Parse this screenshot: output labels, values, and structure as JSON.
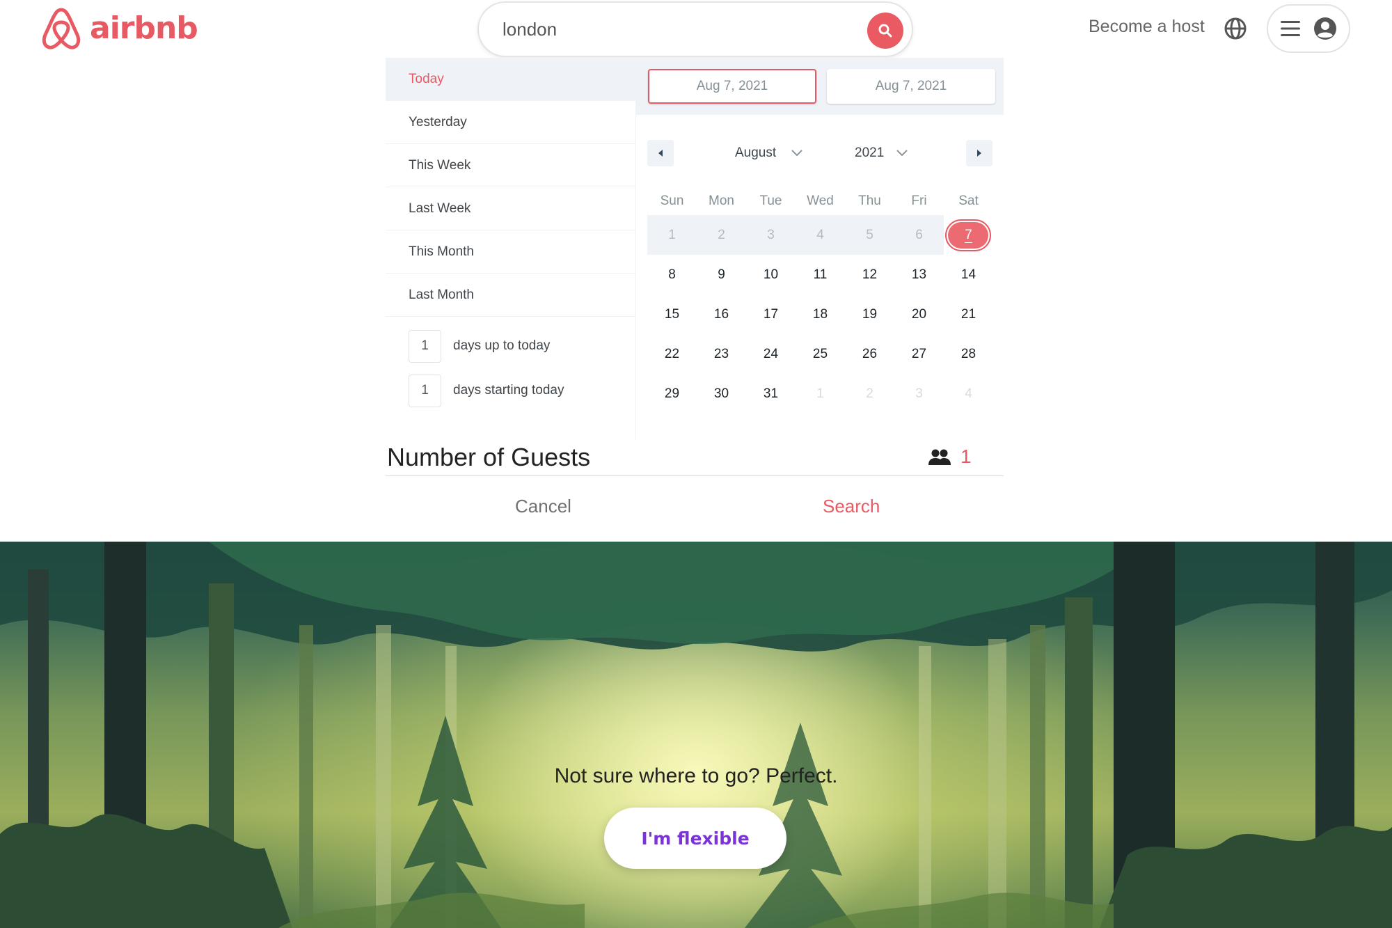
{
  "header": {
    "brand": "airbnb",
    "search_value": "london",
    "become_host": "Become a host",
    "icons": [
      "airbnb-logo-icon",
      "search-icon",
      "globe-icon",
      "hamburger-icon",
      "user-circle-icon"
    ]
  },
  "date_picker": {
    "static_ranges": [
      {
        "label": "Today",
        "active": true
      },
      {
        "label": "Yesterday",
        "active": false
      },
      {
        "label": "This Week",
        "active": false
      },
      {
        "label": "Last Week",
        "active": false
      },
      {
        "label": "This Month",
        "active": false
      },
      {
        "label": "Last Month",
        "active": false
      }
    ],
    "input_ranges": [
      {
        "value": "1",
        "label": "days up to today"
      },
      {
        "value": "1",
        "label": "days starting today"
      }
    ],
    "start_date": "Aug 7, 2021",
    "end_date": "Aug 7, 2021",
    "month": "August",
    "year": "2021",
    "weekdays": [
      "Sun",
      "Mon",
      "Tue",
      "Wed",
      "Thu",
      "Fri",
      "Sat"
    ],
    "days": [
      {
        "d": "1",
        "state": "inrow"
      },
      {
        "d": "2",
        "state": "inrow"
      },
      {
        "d": "3",
        "state": "inrow"
      },
      {
        "d": "4",
        "state": "inrow"
      },
      {
        "d": "5",
        "state": "inrow"
      },
      {
        "d": "6",
        "state": "inrow"
      },
      {
        "d": "7",
        "state": "selected"
      },
      {
        "d": "8",
        "state": "normal"
      },
      {
        "d": "9",
        "state": "normal"
      },
      {
        "d": "10",
        "state": "normal"
      },
      {
        "d": "11",
        "state": "normal"
      },
      {
        "d": "12",
        "state": "normal"
      },
      {
        "d": "13",
        "state": "normal"
      },
      {
        "d": "14",
        "state": "normal"
      },
      {
        "d": "15",
        "state": "normal"
      },
      {
        "d": "16",
        "state": "normal"
      },
      {
        "d": "17",
        "state": "normal"
      },
      {
        "d": "18",
        "state": "normal"
      },
      {
        "d": "19",
        "state": "normal"
      },
      {
        "d": "20",
        "state": "normal"
      },
      {
        "d": "21",
        "state": "normal"
      },
      {
        "d": "22",
        "state": "normal"
      },
      {
        "d": "23",
        "state": "normal"
      },
      {
        "d": "24",
        "state": "normal"
      },
      {
        "d": "25",
        "state": "normal"
      },
      {
        "d": "26",
        "state": "normal"
      },
      {
        "d": "27",
        "state": "normal"
      },
      {
        "d": "28",
        "state": "normal"
      },
      {
        "d": "29",
        "state": "normal"
      },
      {
        "d": "30",
        "state": "normal"
      },
      {
        "d": "31",
        "state": "normal"
      },
      {
        "d": "1",
        "state": "passive"
      },
      {
        "d": "2",
        "state": "passive"
      },
      {
        "d": "3",
        "state": "passive"
      },
      {
        "d": "4",
        "state": "passive"
      }
    ]
  },
  "guests": {
    "title": "Number of Guests",
    "count": "1"
  },
  "actions": {
    "cancel": "Cancel",
    "search": "Search"
  },
  "hero": {
    "tagline": "Not sure where to go? Perfect.",
    "flexible_button": "I'm flexible"
  },
  "colors": {
    "brand": "#e85a63",
    "flexible_text": "#7a33d6",
    "range_bg": "#eff2f7"
  }
}
